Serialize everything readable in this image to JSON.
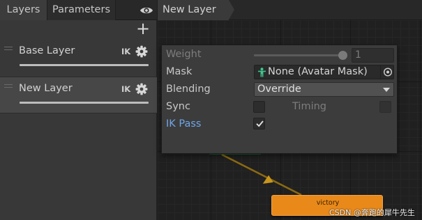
{
  "left_panel": {
    "tabs": [
      {
        "label": "Layers",
        "active": true
      },
      {
        "label": "Parameters",
        "active": false
      }
    ],
    "layers": [
      {
        "name": "Base Layer",
        "ik_label": "IK",
        "selected": false
      },
      {
        "name": "New Layer",
        "ik_label": "IK",
        "selected": true
      }
    ]
  },
  "breadcrumb": {
    "label": "New Layer"
  },
  "popup": {
    "weight": {
      "label": "Weight",
      "value": "1",
      "slider_fraction": 1.0
    },
    "mask": {
      "label": "Mask",
      "value": "None (Avatar Mask)"
    },
    "blending": {
      "label": "Blending",
      "value": "Override"
    },
    "sync": {
      "label": "Sync",
      "checked": false
    },
    "timing": {
      "label": "Timing",
      "checked": false
    },
    "ik_pass": {
      "label": "IK Pass",
      "checked": true
    }
  },
  "graph": {
    "state": {
      "label": "victory",
      "color": "#e8891a"
    }
  },
  "watermark": "CSDN @奔跑的犀牛先生",
  "colors": {
    "accent_blue": "#6fa6e8",
    "state_orange": "#e8891a",
    "transition": "#8c6a12"
  }
}
